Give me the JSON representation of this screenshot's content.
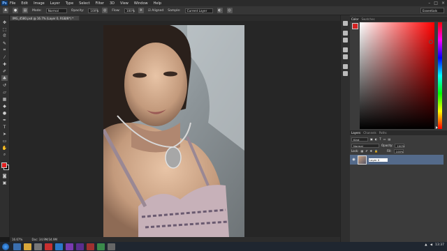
{
  "menubar": {
    "logo": "Ps",
    "items": [
      "File",
      "Edit",
      "Image",
      "Layer",
      "Type",
      "Select",
      "Filter",
      "3D",
      "View",
      "Window",
      "Help"
    ],
    "window_controls": [
      "–",
      "□",
      "×"
    ]
  },
  "options_bar": {
    "mode_label": "Mode:",
    "mode_value": "Normal",
    "opacity_label": "Opacity:",
    "opacity_value": "100%",
    "flow_label": "Flow:",
    "flow_value": "100%",
    "aligned_label": "Aligned",
    "sample_label": "Sample:",
    "sample_value": "Current Layer",
    "workspace": "Essentials"
  },
  "document": {
    "tab_title": "IMG_4580.psd @ 16.7% (Layer 0, RGB/8*) *",
    "zoom": "16.67%",
    "status_info": "Doc: 34.9M/34.9M"
  },
  "color_panel": {
    "tabs": [
      "Color",
      "Swatches"
    ],
    "foreground": "#d42222"
  },
  "layers_panel": {
    "tabs": [
      "Layers",
      "Channels",
      "Paths"
    ],
    "kind_label": "Kind",
    "blend_mode": "Normal",
    "opacity_label": "Opacity:",
    "opacity_value": "100%",
    "lock_label": "Lock:",
    "fill_label": "Fill:",
    "fill_value": "100%",
    "layer_name": "Layer 0"
  },
  "taskbar": {
    "time": "13:37"
  }
}
